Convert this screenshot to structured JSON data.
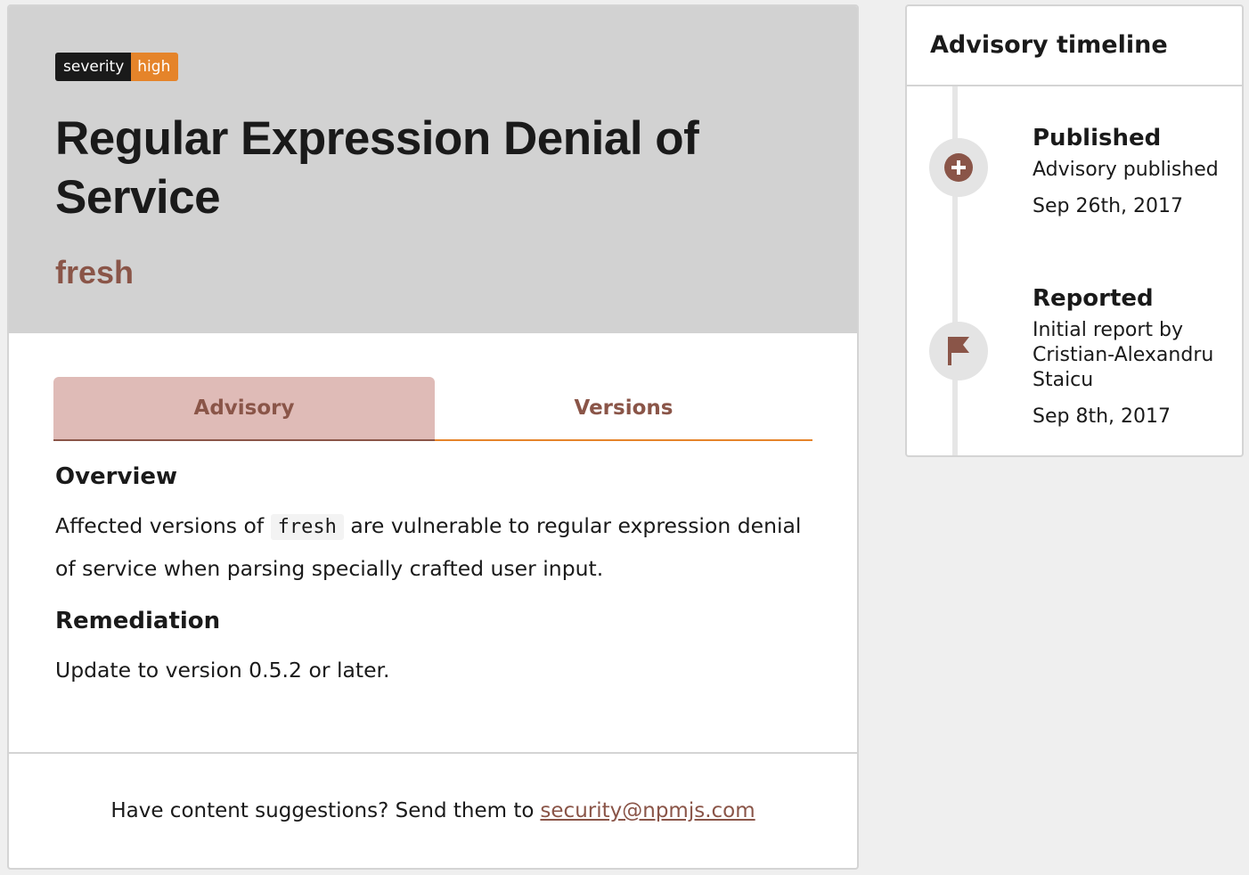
{
  "advisory": {
    "badge": {
      "key": "severity",
      "value": "high"
    },
    "title": "Regular Expression Denial of Service",
    "package": "fresh"
  },
  "tabs": [
    {
      "label": "Advisory",
      "active": true
    },
    {
      "label": "Versions",
      "active": false
    }
  ],
  "content": {
    "overview_heading": "Overview",
    "overview_prefix": "Affected versions of",
    "overview_code": "fresh",
    "overview_suffix": "are vulnerable to regular expression denial of service when parsing specially crafted user input.",
    "remediation_heading": "Remediation",
    "remediation_text": "Update to version 0.5.2 or later."
  },
  "footer": {
    "text": "Have content suggestions? Send them to",
    "email": "security@npmjs.com"
  },
  "timeline": {
    "title": "Advisory timeline",
    "events": [
      {
        "icon": "plus-circle-icon",
        "title": "Published",
        "description": "Advisory published",
        "date": "Sep 26th, 2017"
      },
      {
        "icon": "flag-icon",
        "title": "Reported",
        "description": "Initial report by Cristian-Alexandru Staicu",
        "date": "Sep 8th, 2017"
      }
    ]
  },
  "colors": {
    "accent": "#8a5548",
    "severity_high": "#e5842a",
    "hero_bg": "#d2d2d2",
    "active_tab_bg": "#dfbbb7"
  }
}
